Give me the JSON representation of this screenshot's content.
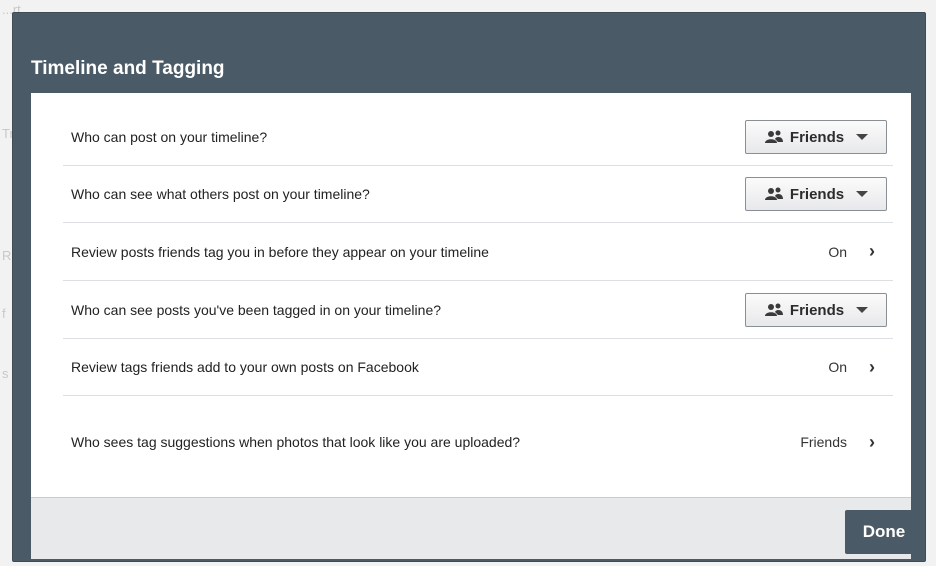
{
  "background": {
    "fragments": [
      "...rt",
      "Tr",
      "R",
      "f",
      "s"
    ]
  },
  "dialog": {
    "title": "Timeline and Tagging",
    "rows": [
      {
        "label": "Who can post on your timeline?",
        "control": "dropdown",
        "value": "Friends",
        "icon": "friends-icon"
      },
      {
        "label": "Who can see what others post on your timeline?",
        "control": "dropdown",
        "value": "Friends",
        "icon": "friends-icon"
      },
      {
        "label": "Review posts friends tag you in before they appear on your timeline",
        "control": "link",
        "value": "On",
        "icon": "chevron-right-icon"
      },
      {
        "label": "Who can see posts you've been tagged in on your timeline?",
        "control": "dropdown",
        "value": "Friends",
        "icon": "friends-icon"
      },
      {
        "label": "Review tags friends add to your own posts on Facebook",
        "control": "link",
        "value": "On",
        "icon": "chevron-right-icon"
      },
      {
        "label": "Who sees tag suggestions when photos that look like you are uploaded?",
        "control": "link",
        "value": "Friends",
        "icon": "chevron-right-icon"
      }
    ],
    "footer": {
      "done_label": "Done"
    }
  },
  "colors": {
    "header_bg": "#4a5a66",
    "body_bg": "#ffffff",
    "footer_bg": "#e8e9eb",
    "text": "#222222"
  }
}
